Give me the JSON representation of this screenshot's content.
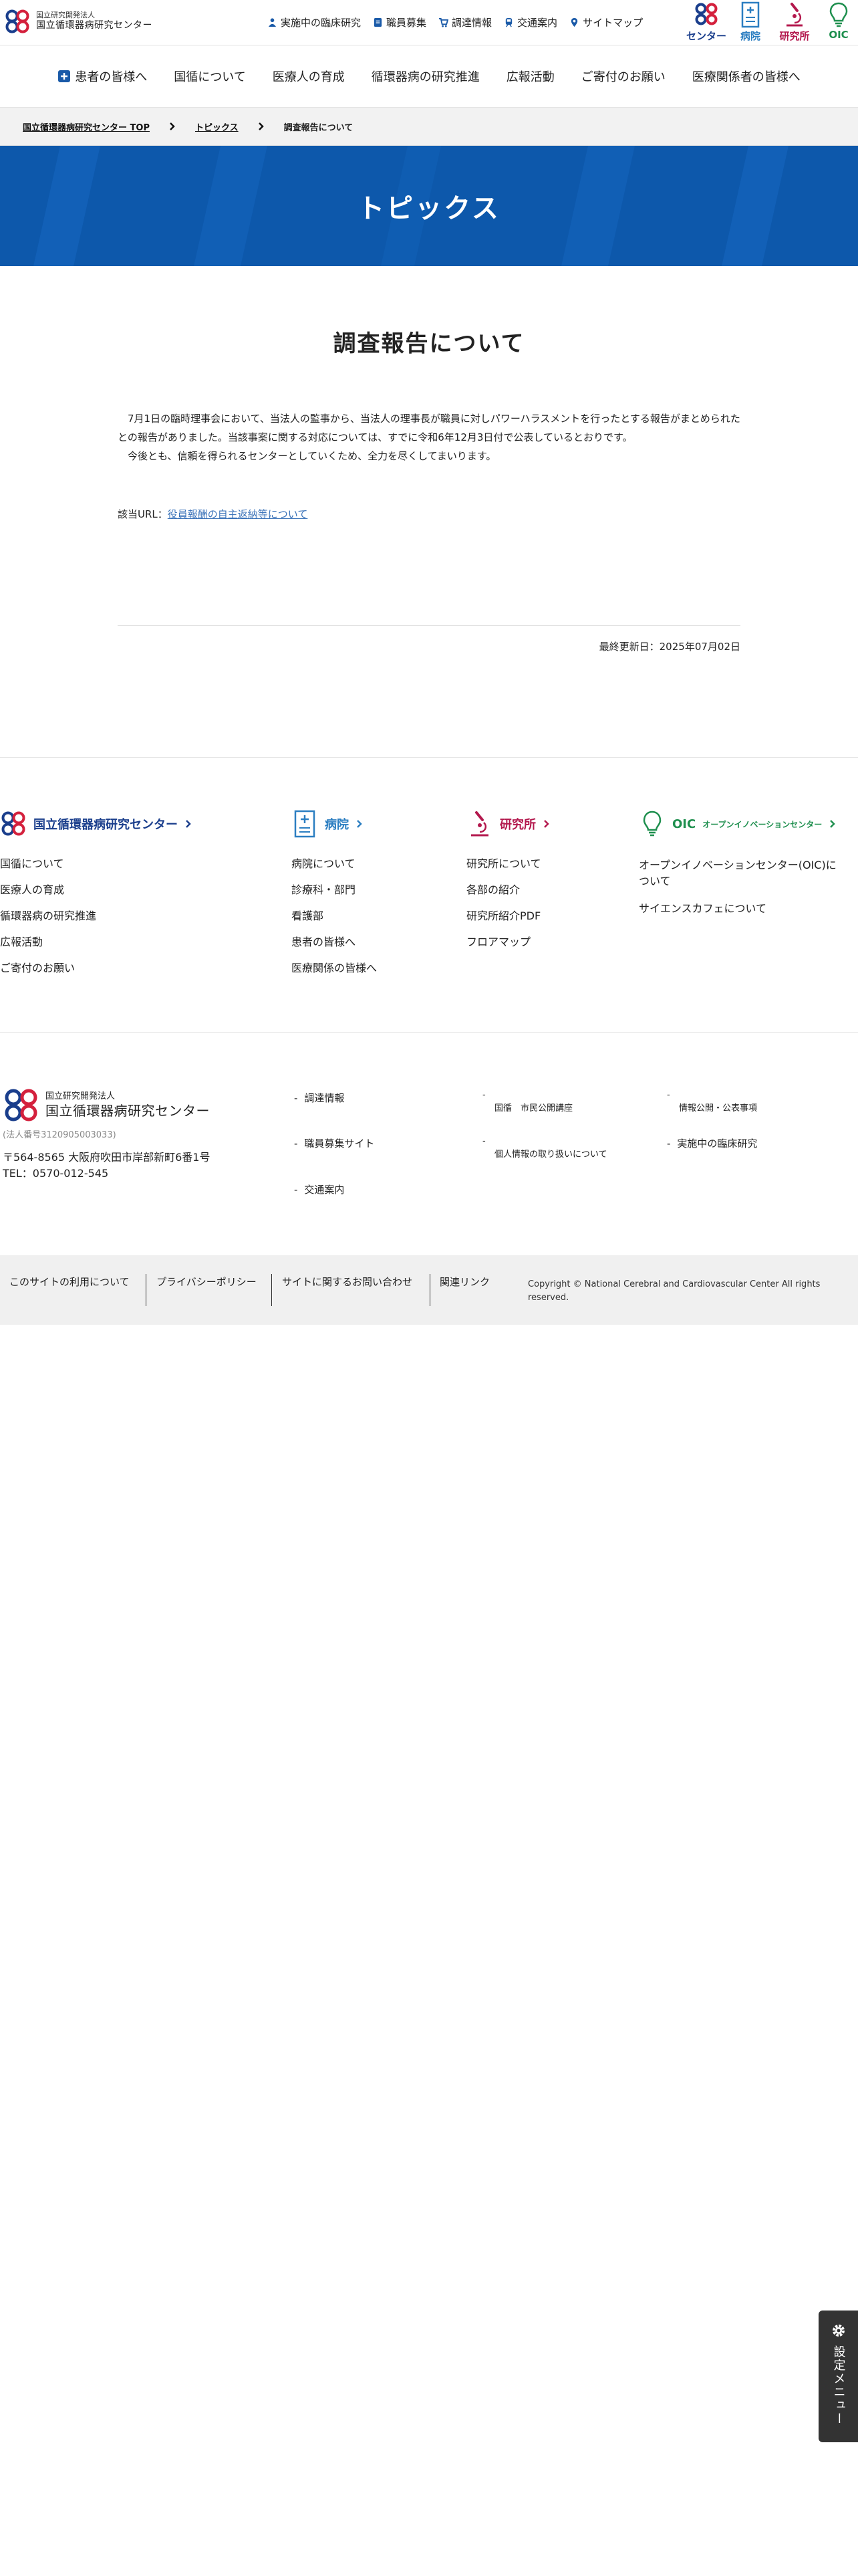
{
  "header": {
    "logo_sub": "国立研究開発法人",
    "logo_main": "国立循環器病研究センター",
    "util_links": [
      {
        "label": "実施中の臨床研究",
        "icon": "person-icon"
      },
      {
        "label": "職員募集",
        "icon": "document-icon"
      },
      {
        "label": "調達情報",
        "icon": "cart-icon"
      },
      {
        "label": "交通案内",
        "icon": "train-icon"
      },
      {
        "label": "サイトマップ",
        "icon": "pin-icon"
      }
    ],
    "switch": [
      {
        "label": "センター",
        "color": "#1a3e8c"
      },
      {
        "label": "病院",
        "color": "#2b7ec1"
      },
      {
        "label": "研究所",
        "color": "#b3184d"
      },
      {
        "label": "OIC",
        "color": "#1e8f4e"
      }
    ]
  },
  "gnav": [
    "患者の皆様へ",
    "国循について",
    "医療人の育成",
    "循環器病の研究推進",
    "広報活動",
    "ご寄付のお願い",
    "医療関係者の皆様へ"
  ],
  "breadcrumb": {
    "home": "国立循環器病研究センター TOP",
    "parent": "トピックス",
    "current": "調査報告について"
  },
  "hero": {
    "title": "トピックス",
    "bg_color": "#0d58ab"
  },
  "article": {
    "title": "調査報告について",
    "paragraph1": "7月1日の臨時理事会において、当法人の監事から、当法人の理事長が職員に対しパワーハラスメントを行ったとする報告がまとめられたとの報告がありました。当該事案に関する対応については、すでに令和6年12月3日付で公表しているとおりです。",
    "paragraph2": "今後とも、信頼を得られるセンターとしていくため、全力を尽くしてまいります。",
    "related_label": "該当URL：",
    "related_link": "役員報酬の自主返納等について",
    "updated": "最終更新日：2025年07月02日"
  },
  "footer_cols": [
    {
      "title": "国立循環器病研究センター",
      "color": "#1a3e8c",
      "links": [
        "国循について",
        "医療人の育成",
        "循環器病の研究推進",
        "広報活動",
        "ご寄付のお願い"
      ]
    },
    {
      "title": "病院",
      "color": "#2b7ec1",
      "links": [
        "病院について",
        "診療科・部門",
        "看護部",
        "患者の皆様へ",
        "医療関係の皆様へ"
      ]
    },
    {
      "title": "研究所",
      "color": "#b3184d",
      "links": [
        "研究所について",
        "各部の紹介",
        "研究所紹介PDF",
        "フロアマップ"
      ]
    },
    {
      "title": "OIC",
      "subtitle": "オープンイノベーションセンター",
      "color": "#1e8f4e",
      "links": [
        "オープンイノベーションセンター(OIC)について",
        "サイエンスカフェについて"
      ]
    }
  ],
  "footer_info": {
    "logo_sub": "国立研究開発法人",
    "logo_main": "国立循環器病研究センター",
    "corp_number": "(法人番号3120905003033)",
    "address": "〒564-8565 大阪府吹田市岸部新町6番1号",
    "tel": "TEL：0570-012-545",
    "dash": "-",
    "links_col1": [
      "調達情報",
      "職員募集サイト",
      "交通案内"
    ],
    "links_col2": [
      "国循　市民公開講座",
      "個人情報の取り扱いについて"
    ],
    "links_col3": [
      "情報公開・公表事項",
      "実施中の臨床研究"
    ]
  },
  "bottom_bar": {
    "links": [
      "このサイトの利用について",
      "プライバシーポリシー",
      "サイトに関するお問い合わせ",
      "関連リンク"
    ],
    "copyright": "Copyright © National Cerebral and Cardiovascular Center All rights reserved."
  },
  "settings": {
    "label": "設定メニュー"
  }
}
